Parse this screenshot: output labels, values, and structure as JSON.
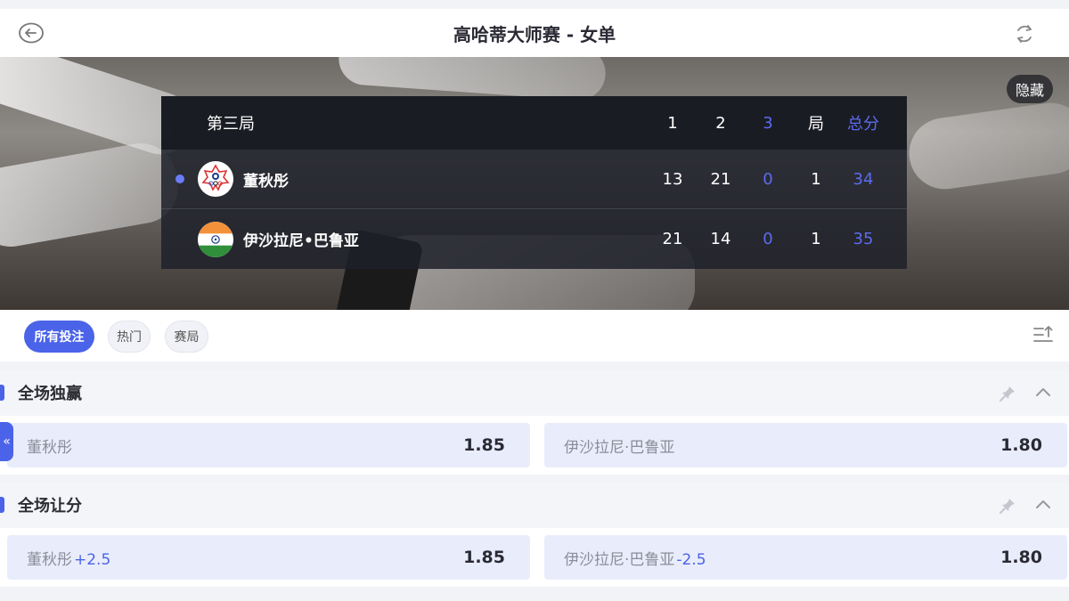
{
  "header": {
    "title": "高哈蒂大师赛 - 女单",
    "back_icon": "arrow-left-circle-icon",
    "refresh_icon": "refresh-icon"
  },
  "banner": {
    "hide_label": "隐藏"
  },
  "scoreboard": {
    "headers": {
      "game_label": "第三局",
      "col1": "1",
      "col2": "2",
      "col3": "3",
      "col4": "局",
      "col5": "总分"
    },
    "players": [
      {
        "name": "董秋彤",
        "serving": true,
        "flag": "chinese-taipei-olympic-flag",
        "g1": "13",
        "g2": "21",
        "g3": "0",
        "games": "1",
        "total": "34"
      },
      {
        "name": "伊沙拉尼•巴鲁亚",
        "serving": false,
        "flag": "india-flag",
        "g1": "21",
        "g2": "14",
        "g3": "0",
        "games": "1",
        "total": "35"
      }
    ],
    "accent_color": "#5b6cf0"
  },
  "tabs": [
    {
      "label": "所有投注",
      "active": true
    },
    {
      "label": "热门",
      "active": false
    },
    {
      "label": "赛局",
      "active": false
    }
  ],
  "side_tab": {
    "label": "«"
  },
  "markets": [
    {
      "title": "全场独赢",
      "odds": [
        {
          "name": "董秋彤",
          "handicap": "",
          "value": "1.85"
        },
        {
          "name": "伊沙拉尼·巴鲁亚",
          "handicap": "",
          "value": "1.80"
        }
      ]
    },
    {
      "title": "全场让分",
      "odds": [
        {
          "name": "董秋彤",
          "handicap": "+2.5",
          "value": "1.85"
        },
        {
          "name": "伊沙拉尼·巴鲁亚",
          "handicap": "-2.5",
          "value": "1.80"
        }
      ]
    }
  ],
  "colors": {
    "accent": "#4a63e8",
    "odd_bg": "#e9ecfb"
  }
}
